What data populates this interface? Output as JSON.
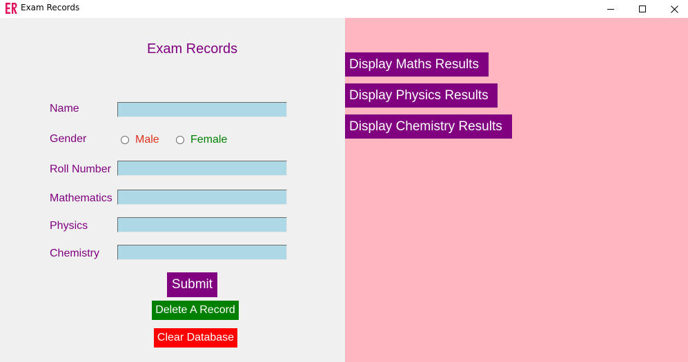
{
  "window": {
    "title": "Exam Records",
    "icon": "er-logo-icon",
    "controls": {
      "minimize": "minimize-icon",
      "maximize": "maximize-icon",
      "close": "close-icon"
    }
  },
  "form": {
    "title": "Exam Records",
    "labels": {
      "name": "Name",
      "gender": "Gender",
      "roll": "Roll Number",
      "maths": "Mathematics",
      "physics": "Physics",
      "chemistry": "Chemistry"
    },
    "values": {
      "name": "",
      "roll": "",
      "maths": "",
      "physics": "",
      "chemistry": ""
    },
    "gender_options": [
      {
        "label": "Male",
        "color": "#e0301e"
      },
      {
        "label": "Female",
        "color": "#008000"
      }
    ]
  },
  "buttons": {
    "submit": "Submit",
    "delete": "Delete A Record",
    "clear": "Clear Database"
  },
  "results": {
    "maths": "Display Maths Results",
    "physics": "Display Physics Results",
    "chemistry": "Display Chemistry Results"
  },
  "colors": {
    "label": "#800080",
    "input_bg": "#add8e6",
    "left_bg": "#f0f0f0",
    "right_bg": "#ffb6c1",
    "purple_btn": "#800080",
    "green_btn": "#008000",
    "red_btn": "#ff0000"
  }
}
